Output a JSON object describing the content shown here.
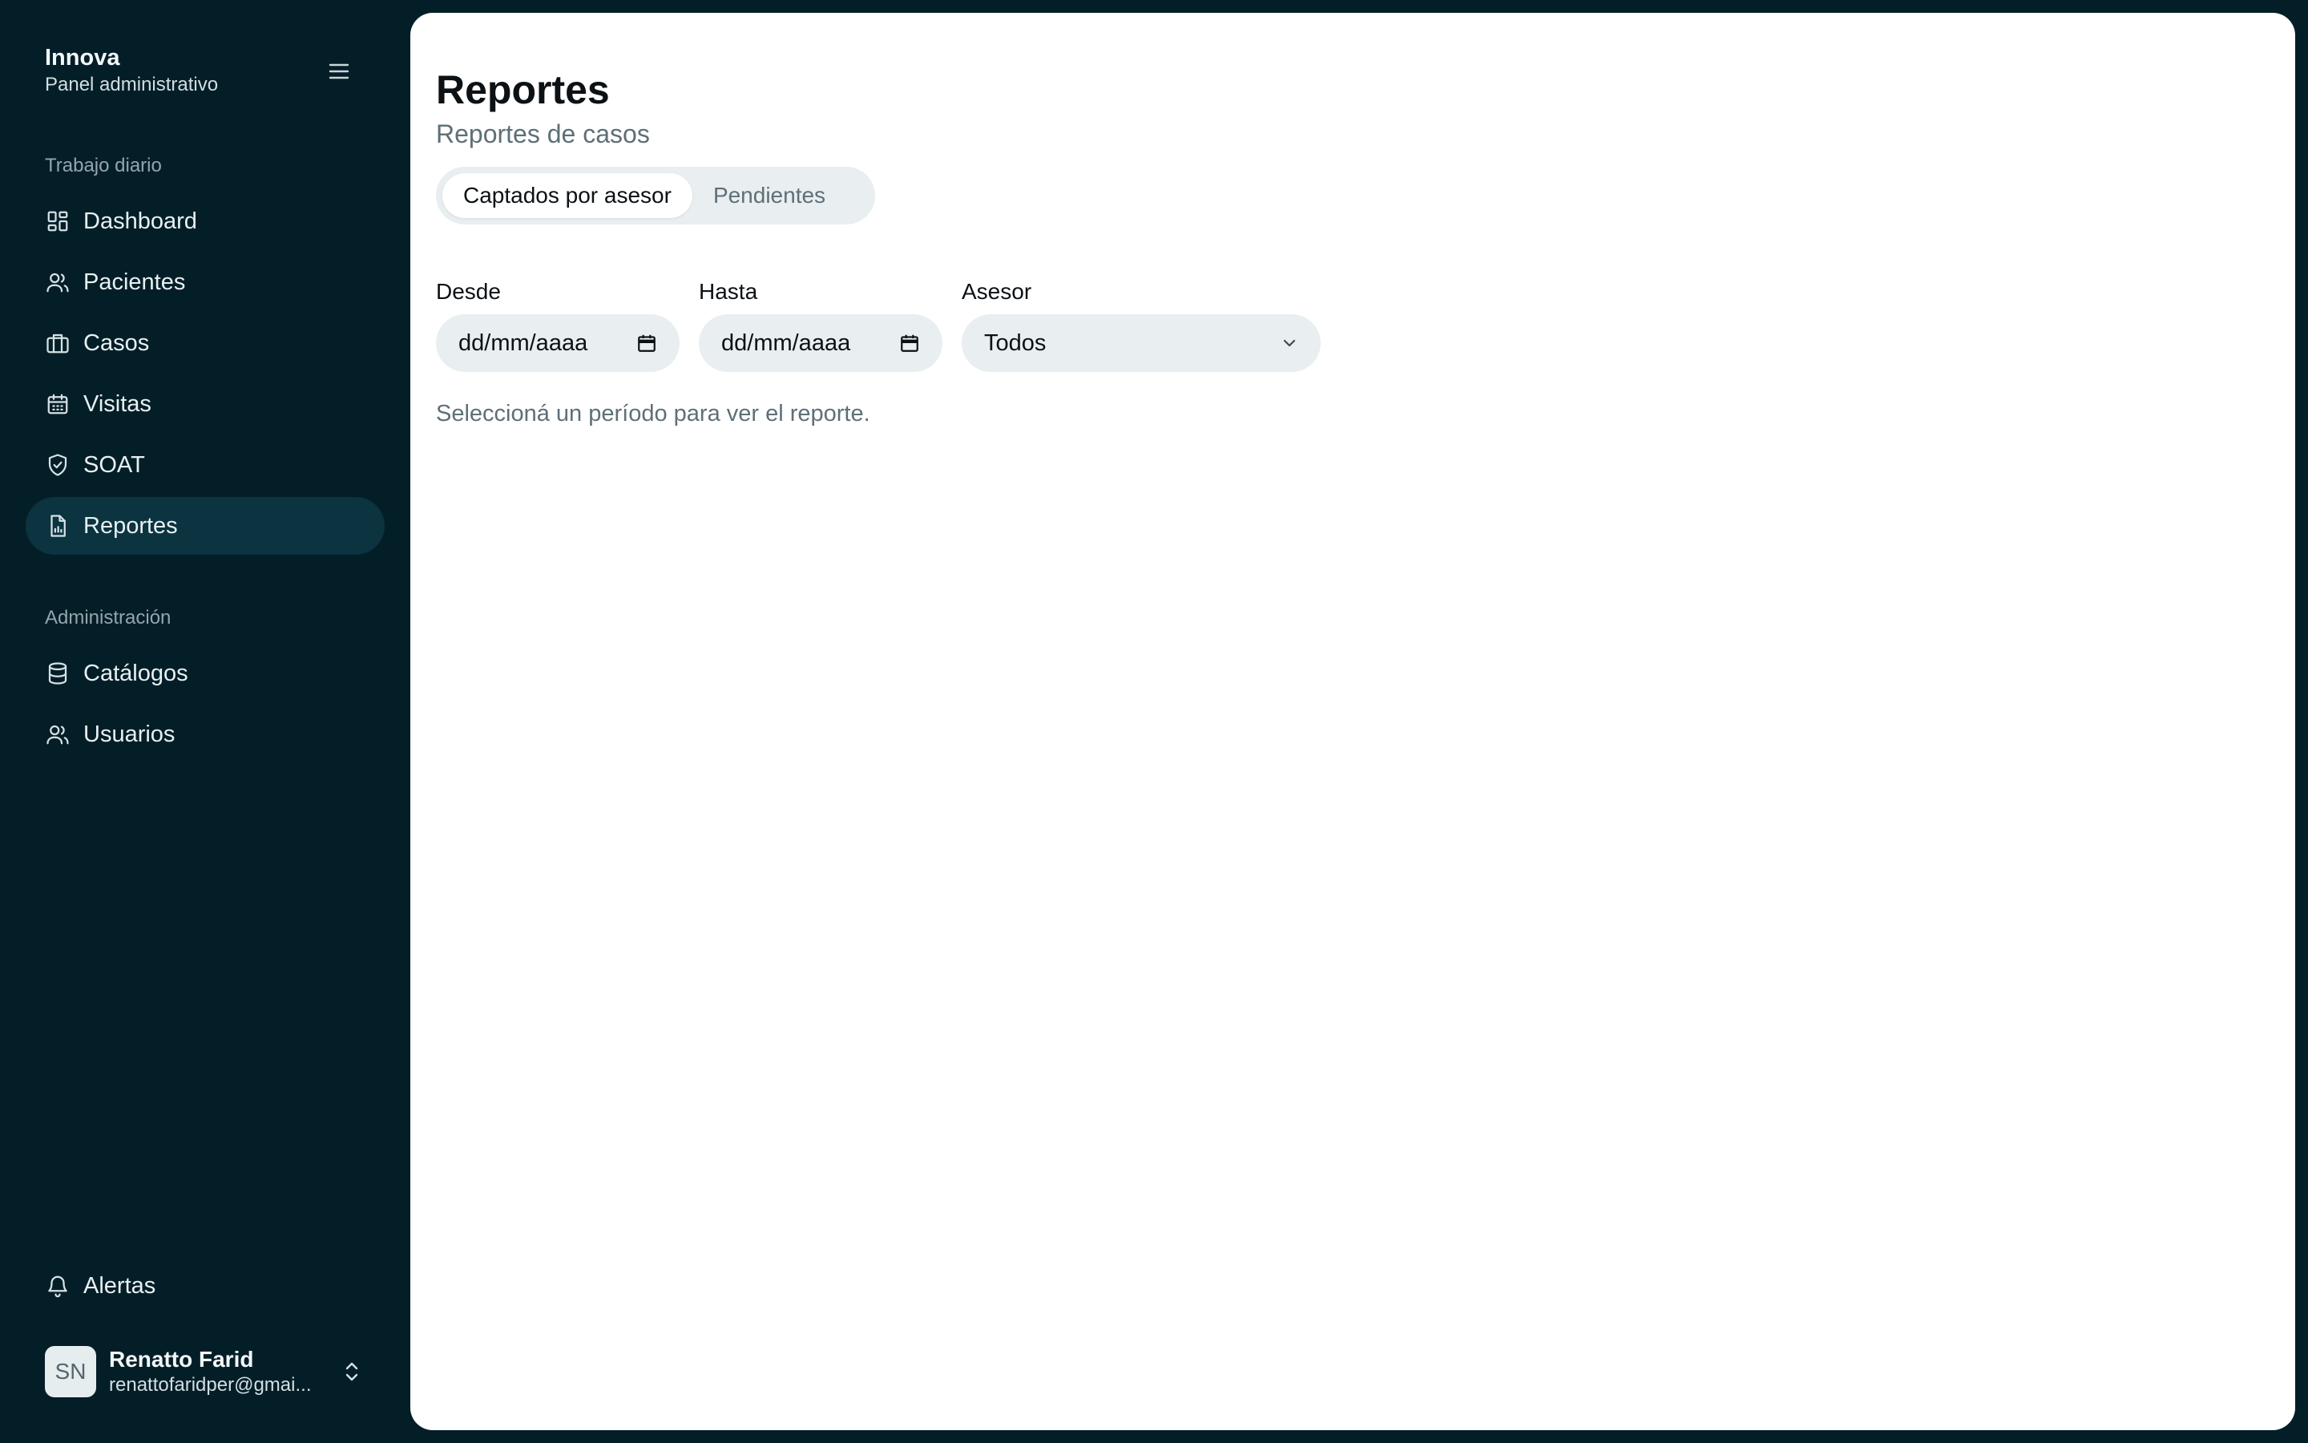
{
  "brand": {
    "title": "Innova",
    "subtitle": "Panel administrativo"
  },
  "sidebar": {
    "sections": [
      {
        "label": "Trabajo diario"
      },
      {
        "label": "Administración"
      }
    ],
    "items": [
      {
        "label": "Dashboard",
        "icon": "dashboard-icon",
        "active": false
      },
      {
        "label": "Pacientes",
        "icon": "users-icon",
        "active": false
      },
      {
        "label": "Casos",
        "icon": "briefcase-icon",
        "active": false
      },
      {
        "label": "Visitas",
        "icon": "calendar-icon",
        "active": false
      },
      {
        "label": "SOAT",
        "icon": "shield-check-icon",
        "active": false
      },
      {
        "label": "Reportes",
        "icon": "file-chart-icon",
        "active": true
      },
      {
        "label": "Catálogos",
        "icon": "database-icon",
        "active": false
      },
      {
        "label": "Usuarios",
        "icon": "users-icon",
        "active": false
      }
    ],
    "alerts": {
      "label": "Alertas",
      "icon": "bell-icon"
    }
  },
  "user": {
    "initials": "SN",
    "name": "Renatto Farid",
    "email": "renattofaridper@gmai..."
  },
  "main": {
    "title": "Reportes",
    "subtitle": "Reportes de casos",
    "tabs": [
      {
        "label": "Captados por asesor",
        "active": true
      },
      {
        "label": "Pendientes",
        "active": false
      }
    ],
    "filters": {
      "from": {
        "label": "Desde",
        "placeholder": "dd/mm/aaaa"
      },
      "to": {
        "label": "Hasta",
        "placeholder": "dd/mm/aaaa"
      },
      "advisor": {
        "label": "Asesor",
        "value": "Todos"
      }
    },
    "hint": "Seleccioná un período para ver el reporte."
  },
  "colors": {
    "sidebar_bg": "#041e28",
    "active_item_bg": "#0b3340",
    "panel_bg": "#ffffff",
    "field_bg": "#e9eef0",
    "muted_text": "#5e6f77"
  }
}
